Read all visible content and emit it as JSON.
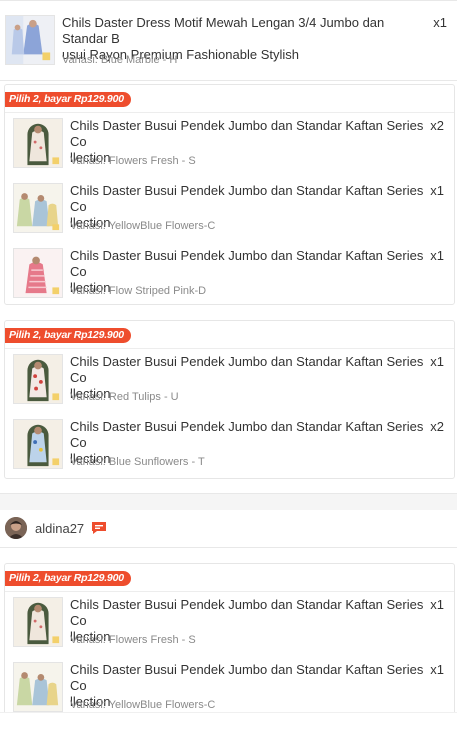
{
  "top_item": {
    "title": "Chils Daster Dress Motif Mewah Lengan 3/4 Jumbo dan Standar B usui Rayon Premium Fashionable Stylish",
    "title_line1": "Chils Daster Dress Motif Mewah Lengan 3/4 Jumbo dan Standar B",
    "title_line2": "usui Rayon Premium Fashionable Stylish",
    "variant": "Variasi: Blue Marble - H",
    "qty": "x1"
  },
  "bundles": [
    {
      "tag": "Pilih 2, bayar Rp129.900",
      "items": [
        {
          "line1": "Chils Daster Busui Pendek Jumbo dan Standar Kaftan Series Co",
          "line2": "llection",
          "variant": "Variasi: Flowers Fresh - S",
          "qty": "x2"
        },
        {
          "line1": "Chils Daster Busui Pendek Jumbo dan Standar Kaftan Series Co",
          "line2": "llection",
          "variant": "Variasi: YellowBlue Flowers-C",
          "qty": "x1"
        },
        {
          "line1": "Chils Daster Busui Pendek Jumbo dan Standar Kaftan Series Co",
          "line2": "llection",
          "variant": "Variasi: Flow Striped Pink-D",
          "qty": "x1"
        }
      ]
    },
    {
      "tag": "Pilih 2, bayar Rp129.900",
      "items": [
        {
          "line1": "Chils Daster Busui Pendek Jumbo dan Standar Kaftan Series Co",
          "line2": "llection",
          "variant": "Variasi: Red Tulips - U",
          "qty": "x1"
        },
        {
          "line1": "Chils Daster Busui Pendek Jumbo dan Standar Kaftan Series Co",
          "line2": "llection",
          "variant": "Variasi: Blue Sunflowers - T",
          "qty": "x2"
        }
      ]
    },
    {
      "tag": "Pilih 2, bayar Rp129.900",
      "items": [
        {
          "line1": "Chils Daster Busui Pendek Jumbo dan Standar Kaftan Series Co",
          "line2": "llection",
          "variant": "Variasi: Flowers Fresh - S",
          "qty": "x1"
        },
        {
          "line1": "Chils Daster Busui Pendek Jumbo dan Standar Kaftan Series Co",
          "line2": "llection",
          "variant": "Variasi: YellowBlue Flowers-C",
          "qty": "x1"
        }
      ]
    }
  ],
  "seller": {
    "name": "aldina27",
    "chat_icon": "chat-icon"
  },
  "colors": {
    "accent": "#ee4d2d",
    "muted_text": "#8a8a8a"
  }
}
